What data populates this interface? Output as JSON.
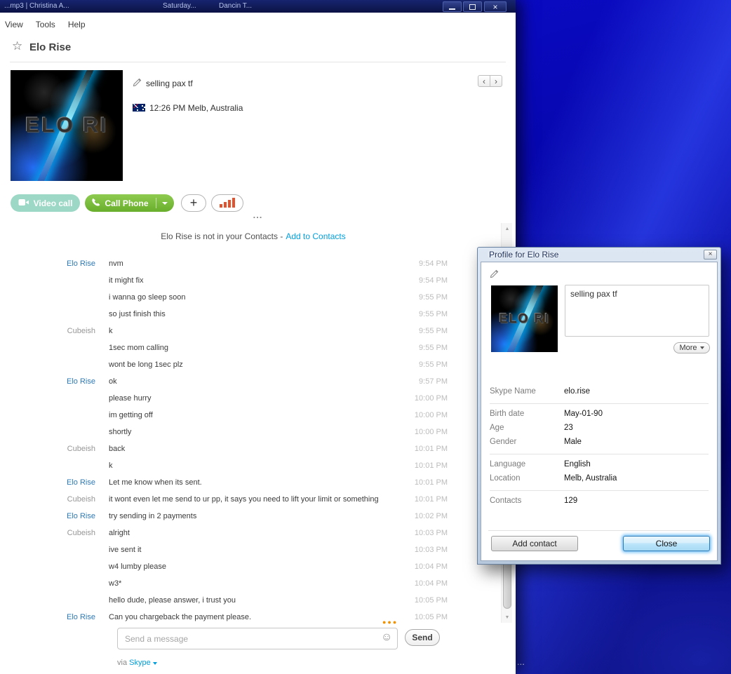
{
  "window": {
    "title_fragments": [
      "...mp3 | Christina A...",
      "Saturday...",
      "Dancin T..."
    ]
  },
  "menubar": {
    "items": [
      "View",
      "Tools",
      "Help"
    ]
  },
  "header": {
    "contact_name": "Elo Rise"
  },
  "profile": {
    "mood": "selling pax tf",
    "time_location": "12:26 PM Melb, Australia",
    "avatar_text": "ELO RI"
  },
  "actions": {
    "video_call_label": "Video call",
    "call_phone_label": "Call Phone"
  },
  "chat": {
    "divider_dots": "...",
    "notice_text": "Elo Rise is not in your Contacts -",
    "notice_link": "Add to Contacts",
    "contact_name": "Elo Rise",
    "other_name": "Cubeish",
    "messages": [
      {
        "sender": "Elo Rise",
        "text": "nvm",
        "time": "9:54 PM"
      },
      {
        "sender": "",
        "text": "it might fix",
        "time": "9:54 PM"
      },
      {
        "sender": "",
        "text": "i wanna go sleep soon",
        "time": "9:55 PM"
      },
      {
        "sender": "",
        "text": "so just finish this",
        "time": "9:55 PM"
      },
      {
        "sender": "Cubeish",
        "text": "k",
        "time": "9:55 PM"
      },
      {
        "sender": "",
        "text": "1sec mom calling",
        "time": "9:55 PM"
      },
      {
        "sender": "",
        "text": "wont be long 1sec plz",
        "time": "9:55 PM"
      },
      {
        "sender": "Elo Rise",
        "text": "ok",
        "time": "9:57 PM"
      },
      {
        "sender": "",
        "text": "please hurry",
        "time": "10:00 PM"
      },
      {
        "sender": "",
        "text": "im getting off",
        "time": "10:00 PM"
      },
      {
        "sender": "",
        "text": "shortly",
        "time": "10:00 PM"
      },
      {
        "sender": "Cubeish",
        "text": "back",
        "time": "10:01 PM"
      },
      {
        "sender": "",
        "text": "k",
        "time": "10:01 PM"
      },
      {
        "sender": "Elo Rise",
        "text": "Let me know when its sent.",
        "time": "10:01 PM"
      },
      {
        "sender": "Cubeish",
        "text": "it wont even let me send to ur pp, it says you need to lift your limit or something",
        "time": "10:01 PM"
      },
      {
        "sender": "Elo Rise",
        "text": "try sending in 2 payments",
        "time": "10:02 PM"
      },
      {
        "sender": "Cubeish",
        "text": "alright",
        "time": "10:03 PM"
      },
      {
        "sender": "",
        "text": "ive sent it",
        "time": "10:03 PM"
      },
      {
        "sender": "",
        "text": "w4 lumby please",
        "time": "10:04 PM"
      },
      {
        "sender": "",
        "text": "w3*",
        "time": "10:04 PM"
      },
      {
        "sender": "",
        "text": "hello dude, please answer, i trust you",
        "time": "10:05 PM"
      },
      {
        "sender": "Elo Rise",
        "text": "Can you chargeback the payment please.",
        "time": "10:05 PM"
      }
    ]
  },
  "composer": {
    "placeholder": "Send a message",
    "send_label": "Send",
    "via_label": "via",
    "via_channel": "Skype"
  },
  "dialog": {
    "title": "Profile for Elo Rise",
    "avatar_text": "ELO RI",
    "mood": "selling pax tf",
    "more_label": "More",
    "fields": [
      {
        "rows": [
          {
            "label": "Skype Name",
            "value": "elo.rise"
          }
        ]
      },
      {
        "rows": [
          {
            "label": "Birth date",
            "value": "May-01-90"
          },
          {
            "label": "Age",
            "value": "23"
          },
          {
            "label": "Gender",
            "value": "Male"
          }
        ]
      },
      {
        "rows": [
          {
            "label": "Language",
            "value": "English"
          },
          {
            "label": "Location",
            "value": "Melb, Australia"
          }
        ]
      },
      {
        "rows": [
          {
            "label": "Contacts",
            "value": "129"
          }
        ]
      }
    ],
    "add_contact_label": "Add contact",
    "close_label": "Close"
  },
  "desktop": {
    "taskbar_dots": "..."
  },
  "colors": {
    "skype_green": "#7bc143",
    "video_teal": "#9cd8c5",
    "link_blue": "#009fdc",
    "contact_name_blue": "#2e79b5",
    "signal_red": "#e2522c",
    "desktop_blue": "#0707ae"
  }
}
